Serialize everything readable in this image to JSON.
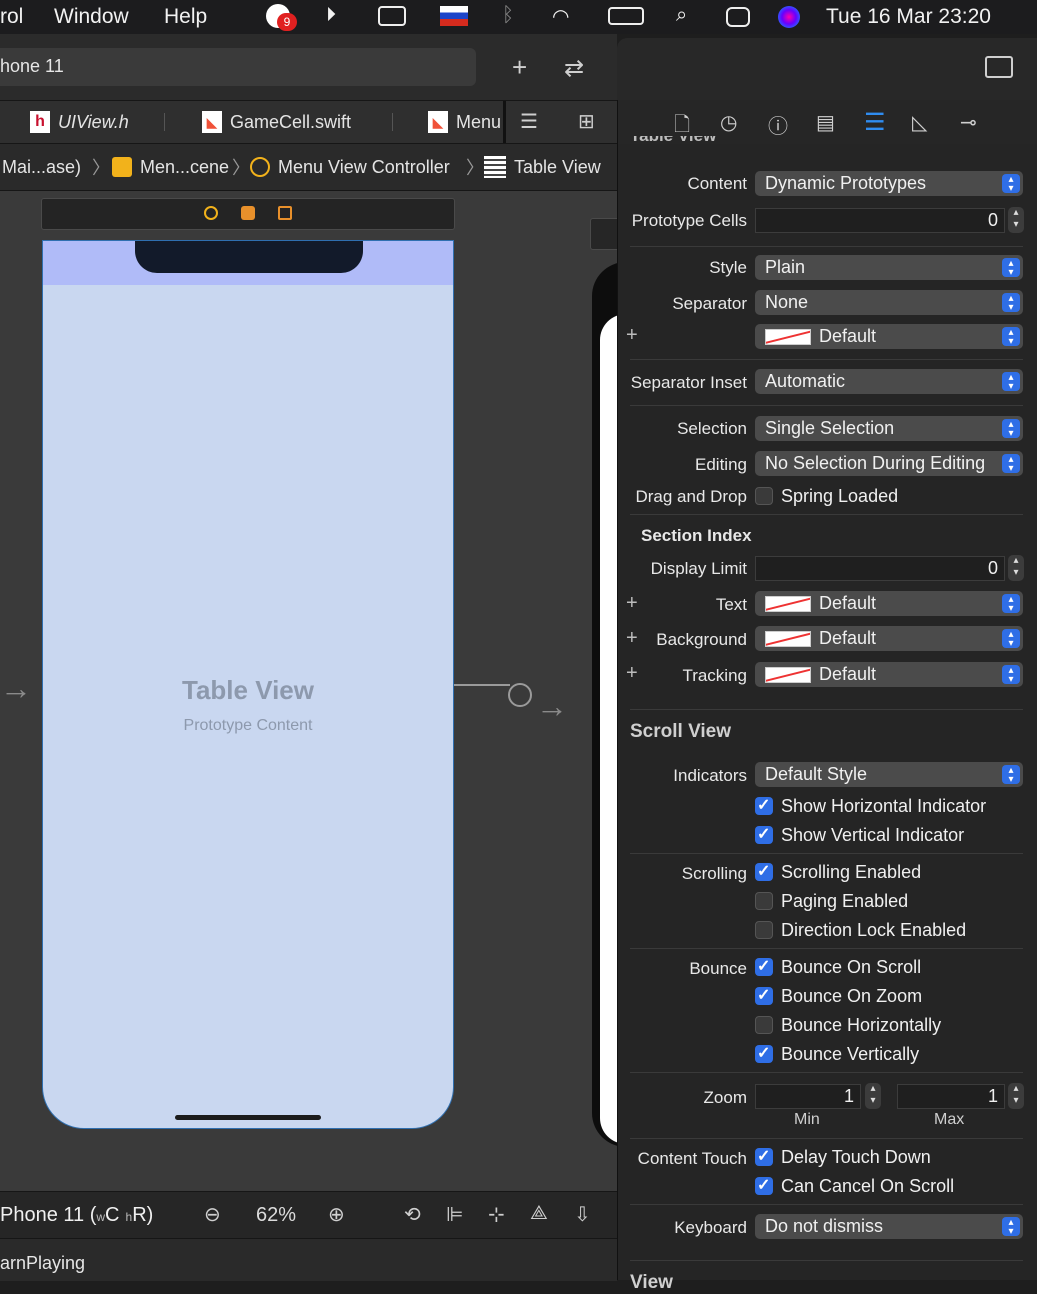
{
  "menubar": {
    "items": [
      "rol",
      "Window",
      "Help"
    ],
    "badge": "9",
    "datetime": "Tue 16 Mar  23:20"
  },
  "toolbar": {
    "scheme": "hone 11"
  },
  "tabs": [
    {
      "label": "UIView.h"
    },
    {
      "label": "GameCell.swift"
    },
    {
      "label": "Menu"
    }
  ],
  "jumpbar": {
    "crumbs": [
      "Mai...ase)",
      "Men...cene",
      "Menu View Controller",
      "Table View"
    ]
  },
  "canvas": {
    "title": "Table View",
    "subtitle": "Prototype Content"
  },
  "bottombar": {
    "device": "Phone 11 (",
    "size_w": "w",
    "size_c": "C",
    "size_h": "h",
    "size_r": "R)",
    "zoom": "62%"
  },
  "debugbar": {
    "text": "arnPlaying"
  },
  "inspector": {
    "header_cut": "Table View",
    "content_label": "Content",
    "content_value": "Dynamic Prototypes",
    "prototype_cells_label": "Prototype Cells",
    "prototype_cells_value": "0",
    "style_label": "Style",
    "style_value": "Plain",
    "separator_label": "Separator",
    "separator_value": "None",
    "separator_color": "Default",
    "separator_inset_label": "Separator Inset",
    "separator_inset_value": "Automatic",
    "selection_label": "Selection",
    "selection_value": "Single Selection",
    "editing_label": "Editing",
    "editing_value": "No Selection During Editing",
    "dnd_label": "Drag and Drop",
    "spring_loaded": "Spring Loaded",
    "section_index_header": "Section Index",
    "display_limit_label": "Display Limit",
    "display_limit_value": "0",
    "text_label": "Text",
    "text_value": "Default",
    "background_label": "Background",
    "background_value": "Default",
    "tracking_label": "Tracking",
    "tracking_value": "Default",
    "scroll_view_header": "Scroll View",
    "indicators_label": "Indicators",
    "indicators_value": "Default Style",
    "show_h": "Show Horizontal Indicator",
    "show_v": "Show Vertical Indicator",
    "scrolling_label": "Scrolling",
    "scrolling_enabled": "Scrolling Enabled",
    "paging_enabled": "Paging Enabled",
    "direction_lock": "Direction Lock Enabled",
    "bounce_label": "Bounce",
    "bounce_scroll": "Bounce On Scroll",
    "bounce_zoom": "Bounce On Zoom",
    "bounce_h": "Bounce Horizontally",
    "bounce_v": "Bounce Vertically",
    "zoom_label": "Zoom",
    "zoom_min_value": "1",
    "zoom_max_value": "1",
    "zoom_min_label": "Min",
    "zoom_max_label": "Max",
    "content_touch_label": "Content Touch",
    "delay_touch": "Delay Touch Down",
    "cancel_scroll": "Can Cancel On Scroll",
    "keyboard_label": "Keyboard",
    "keyboard_value": "Do not dismiss",
    "bottom_cut": "View"
  }
}
